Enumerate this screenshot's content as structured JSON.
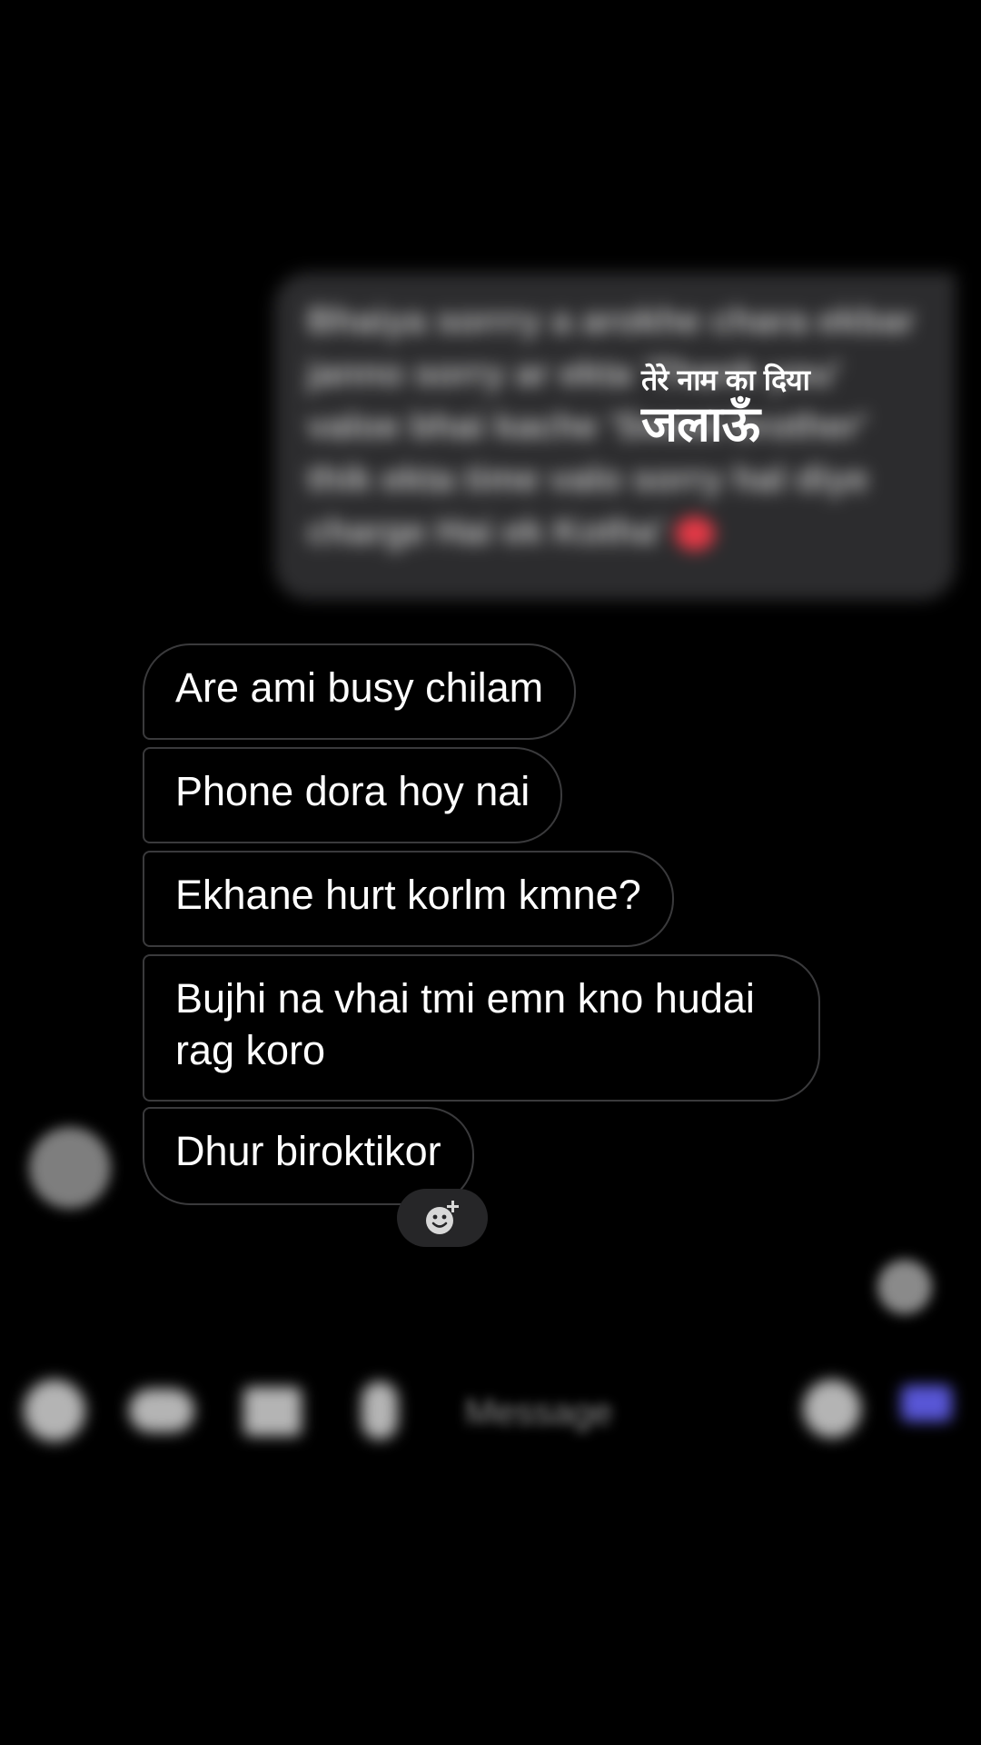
{
  "sent_message": {
    "text": "Bhaiya sorrry a arokhe chara ekbar janno sorry ar ekta 'Thank you' valoe bhai kache 'Sweet brother' thik ekta time valo sorry hal diye charge Hai ek Kotha'",
    "reaction": "heart"
  },
  "overlay_logo": {
    "line1": "तेरे नाम का दिया",
    "line2": "जलाऊँ"
  },
  "received_messages": [
    {
      "text": "Are ami busy chilam"
    },
    {
      "text": "Phone dora hoy nai"
    },
    {
      "text": "Ekhane hurt korlm kmne?"
    },
    {
      "text": "Bujhi na vhai tmi emn kno hudai rag koro"
    },
    {
      "text": "Dhur biroktikor"
    }
  ],
  "reaction_button": {
    "icon": "add-emoji-icon"
  },
  "composer": {
    "placeholder": "Message",
    "icons": [
      "camera-icon",
      "voice-icon",
      "gallery-icon",
      "mic-icon",
      "sticker-icon",
      "send-icon"
    ]
  },
  "colors": {
    "background": "#000000",
    "bubble_border": "#3a3a3c",
    "sent_bubble": "#2c2c2e",
    "send_accent": "#5856d6"
  }
}
